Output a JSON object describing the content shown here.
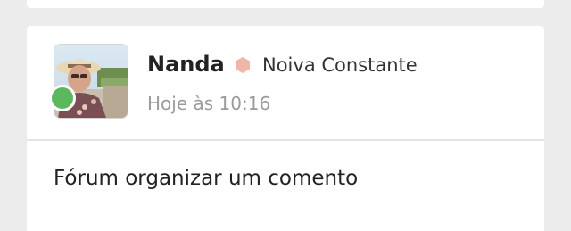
{
  "post": {
    "author": {
      "name": "Nanda",
      "rank": "Noiva Constante",
      "status": "online"
    },
    "timestamp": "Hoje às 10:16",
    "body": "Fórum organizar um comento"
  },
  "colors": {
    "page_background": "#ececec",
    "card_background": "#ffffff",
    "online_status": "#5cb85c",
    "rank_icon": "#f0b6aa",
    "timestamp_text": "#9b9b9b"
  },
  "icons": {
    "rank": "hexagon-icon",
    "status": "online-dot-icon"
  }
}
